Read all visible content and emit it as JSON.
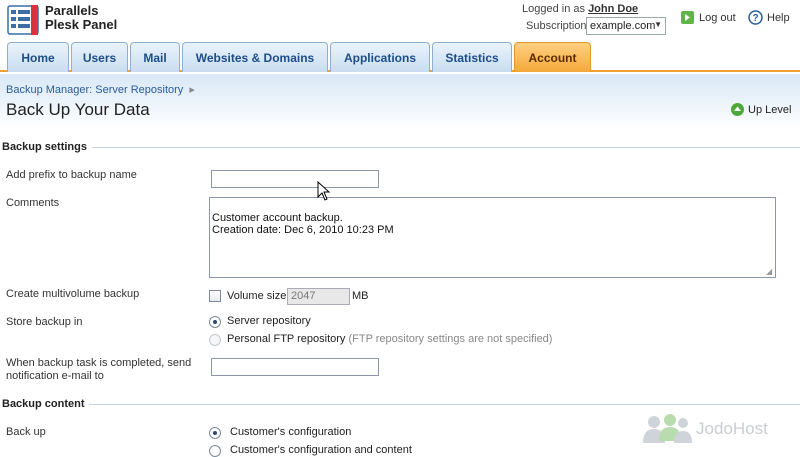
{
  "brand": {
    "line1": "Parallels",
    "line2": "Plesk Panel"
  },
  "header": {
    "logged_in_prefix": "Logged in as",
    "user_name": "John Doe",
    "subscription_label": "Subscription",
    "subscription_value": "example.com",
    "logout_label": "Log out",
    "help_label": "Help"
  },
  "tabs": [
    {
      "label": "Home"
    },
    {
      "label": "Users"
    },
    {
      "label": "Mail"
    },
    {
      "label": "Websites & Domains"
    },
    {
      "label": "Applications"
    },
    {
      "label": "Statistics"
    },
    {
      "label": "Account",
      "active": true
    }
  ],
  "breadcrumb": {
    "item": "Backup Manager: Server Repository",
    "separator": "▸"
  },
  "page": {
    "title": "Back Up Your Data",
    "up_level": "Up Level"
  },
  "backup_settings": {
    "title": "Backup settings",
    "prefix_label": "Add prefix to backup name",
    "prefix_value": "",
    "comments_label": "Comments",
    "comments_value": "Customer account  backup.\nCreation date: Dec 6, 2010 10:23 PM",
    "multivolume_label": "Create multivolume backup",
    "volume_size_label": "Volume size",
    "volume_size_value": "2047",
    "volume_unit": "MB",
    "multivolume_checked": false,
    "store_label": "Store backup in",
    "store_options": [
      {
        "label": "Server repository",
        "selected": true
      },
      {
        "label": "Personal FTP repository",
        "note": "(FTP repository settings are not specified)",
        "selected": false
      }
    ],
    "notify_label_line1": "When backup task is completed, send",
    "notify_label_line2": "notification e-mail to",
    "notify_value": ""
  },
  "backup_content": {
    "title": "Backup content",
    "backup_label": "Back up",
    "options": [
      {
        "label": "Customer's configuration",
        "selected": true
      },
      {
        "label": "Customer's configuration and content",
        "selected": false
      }
    ]
  },
  "watermark": "JodoHost",
  "colors": {
    "active_tab": "#f4a83a",
    "tab_text": "#1d4e8a",
    "link": "#2a5d9a"
  },
  "icons": [
    "plesk-logo-icon",
    "logout-icon",
    "help-icon",
    "up-level-icon",
    "resize-grip-icon",
    "cursor-icon",
    "users-watermark-icon"
  ]
}
